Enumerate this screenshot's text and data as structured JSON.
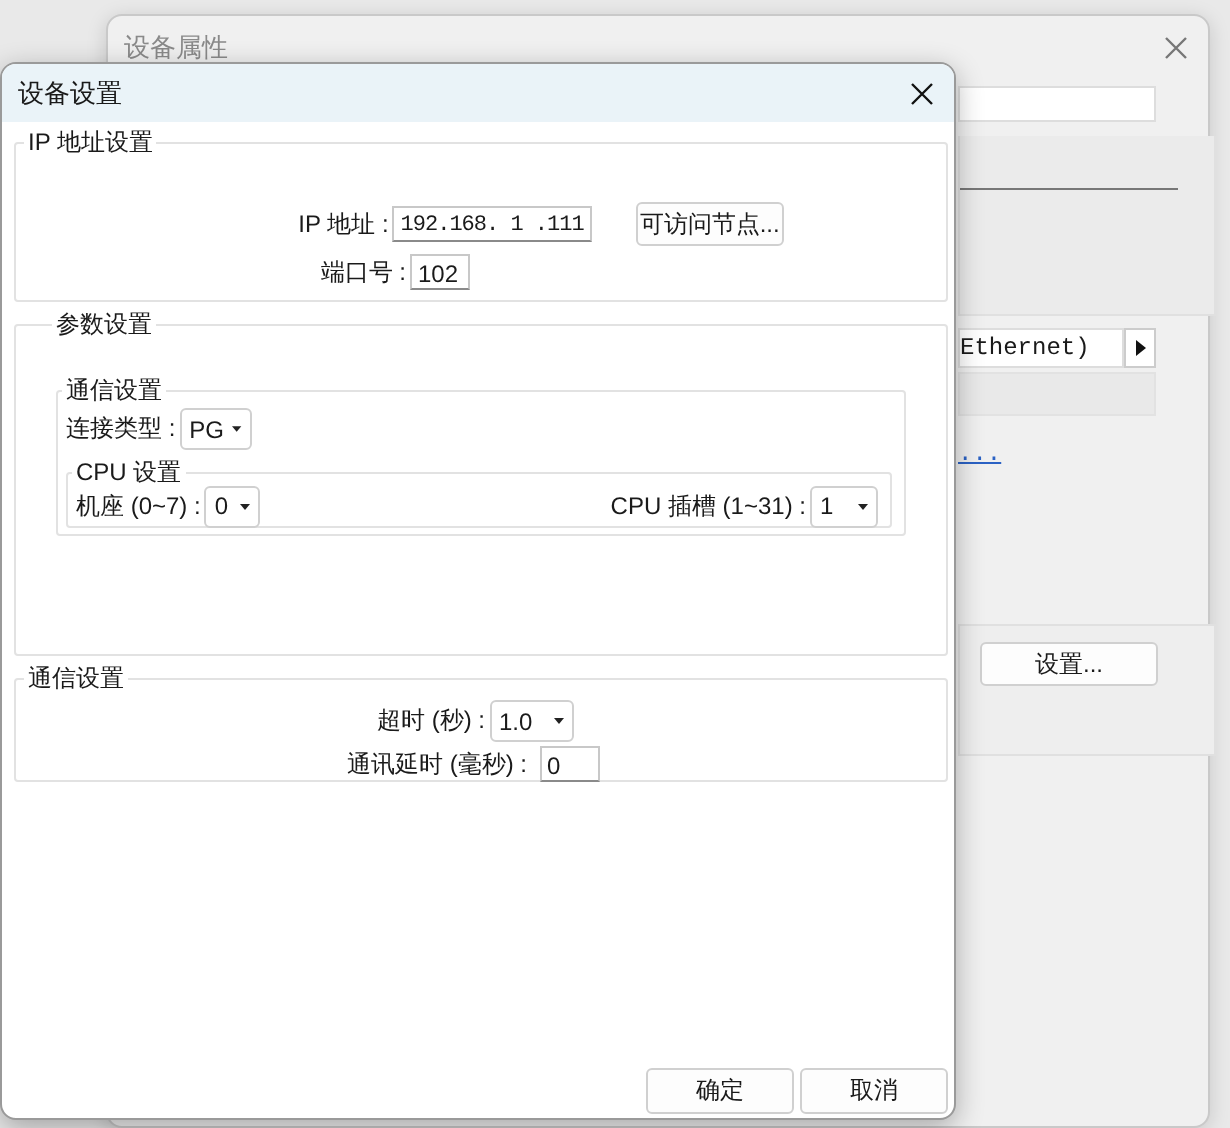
{
  "background_window": {
    "title": "设备属性",
    "interface_field": "Ethernet)",
    "link": "...",
    "settings_button": "设置..."
  },
  "dialog": {
    "title": "设备设置"
  },
  "ip_group": {
    "title": "IP 地址设置",
    "ip_label": "IP 地址 :",
    "ip_value": "192.168. 1 .111",
    "nodes_button": "可访问节点...",
    "port_label": "端口号 :",
    "port_value": "102"
  },
  "params_group": {
    "title": "参数设置",
    "comm": {
      "title": "通信设置",
      "connection_label": "连接类型 :",
      "connection_value": "PG",
      "cpu": {
        "title": "CPU 设置",
        "rack_label": "机座 (0~7) :",
        "rack_value": "0",
        "slot_label": "CPU 插槽 (1~31) :",
        "slot_value": "1"
      }
    }
  },
  "comm_group": {
    "title": "通信设置",
    "timeout_label": "超时 (秒) :",
    "timeout_value": "1.0",
    "delay_label": "通讯延时 (毫秒) :",
    "delay_value": "0"
  },
  "buttons": [
    "确定",
    "取消"
  ]
}
